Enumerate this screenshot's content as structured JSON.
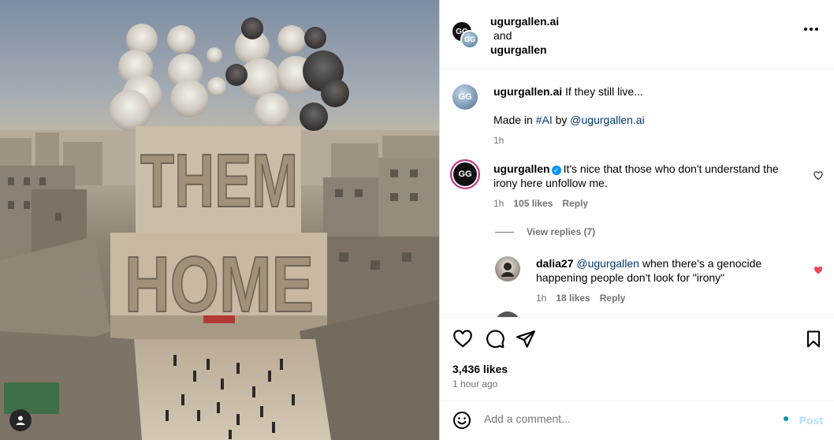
{
  "header": {
    "user1": "ugurgallen.ai",
    "conjunction": "and",
    "user2": "ugurgallen",
    "avatar_initials": "GG"
  },
  "photo": {
    "overlay_text_top": "THEM",
    "overlay_text_bottom": "HOME"
  },
  "caption": {
    "username": "ugurgallen.ai",
    "text": "If they still live...",
    "line2_prefix": "Made in",
    "hashtag": "#AI",
    "line2_mid": "by",
    "mention": "@ugurgallen.ai",
    "time": "1h"
  },
  "comments": [
    {
      "username": "ugurgallen",
      "verified": true,
      "text": "It's nice that those who don't understand the irony here unfollow me.",
      "time": "1h",
      "likes": "105 likes",
      "reply_label": "Reply",
      "liked": false
    },
    {
      "username": "dalia27",
      "mention": "@ugurgallen",
      "text": "when there's a genocide happening people don't look for \"irony\"",
      "time": "1h",
      "likes": "18 likes",
      "reply_label": "Reply",
      "liked": true
    }
  ],
  "view_replies": "View replies (7)",
  "actions": {
    "likes": "3,436 likes",
    "time": "1 hour ago"
  },
  "add_comment": {
    "placeholder": "Add a comment...",
    "post_label": "Post"
  },
  "colors": {
    "link": "#00376b",
    "verified": "#0095f6",
    "liked_heart": "#ed4956",
    "post_disabled": "#b2dffc"
  }
}
